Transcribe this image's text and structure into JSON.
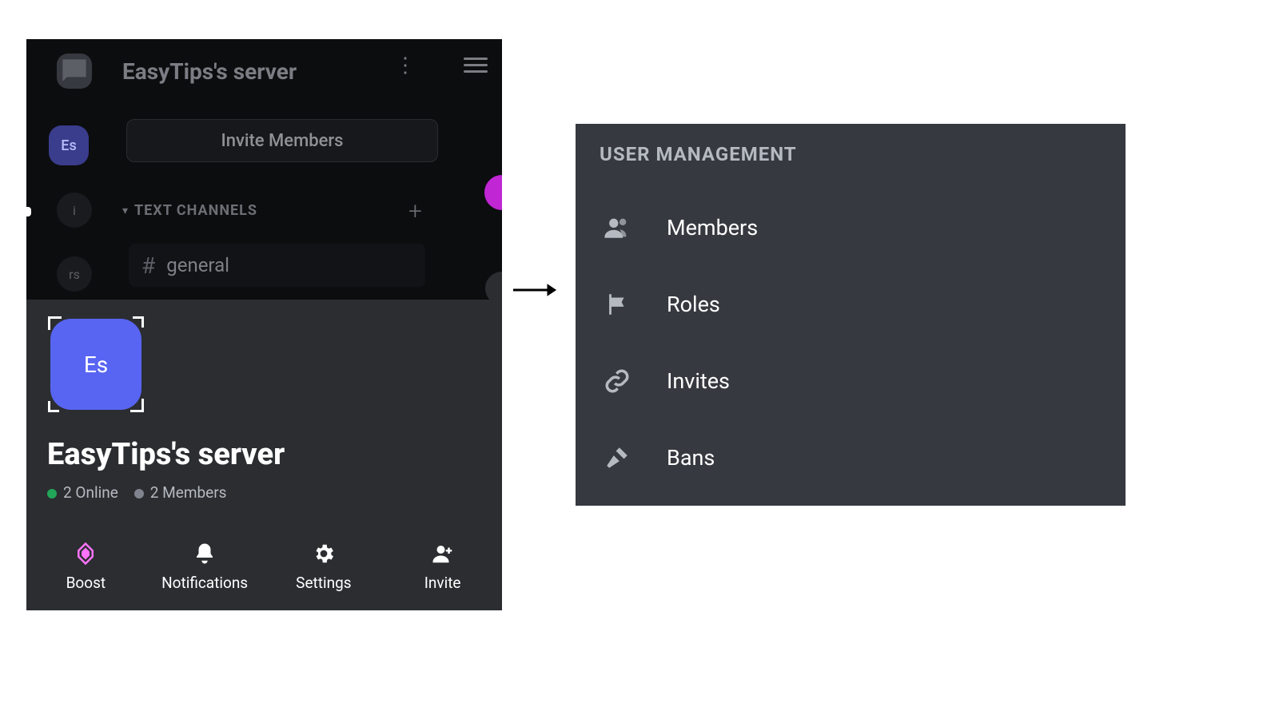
{
  "phone": {
    "header": {
      "title": "EasyTips's server"
    },
    "rail": {
      "server_initials": "Es",
      "stub1": "i",
      "stub2": "rs"
    },
    "invite_button": "Invite Members",
    "section": {
      "label": "TEXT CHANNELS"
    },
    "channel": {
      "name": "general"
    },
    "sheet": {
      "tile_initials": "Es",
      "server_name": "EasyTips's server",
      "online_text": "2 Online",
      "members_text": "2 Members"
    },
    "actions": {
      "boost": "Boost",
      "notifications": "Notifications",
      "settings": "Settings",
      "invite": "Invite"
    }
  },
  "panel": {
    "title": "USER MANAGEMENT",
    "items": [
      {
        "label": "Members"
      },
      {
        "label": "Roles"
      },
      {
        "label": "Invites"
      },
      {
        "label": "Bans"
      }
    ]
  }
}
